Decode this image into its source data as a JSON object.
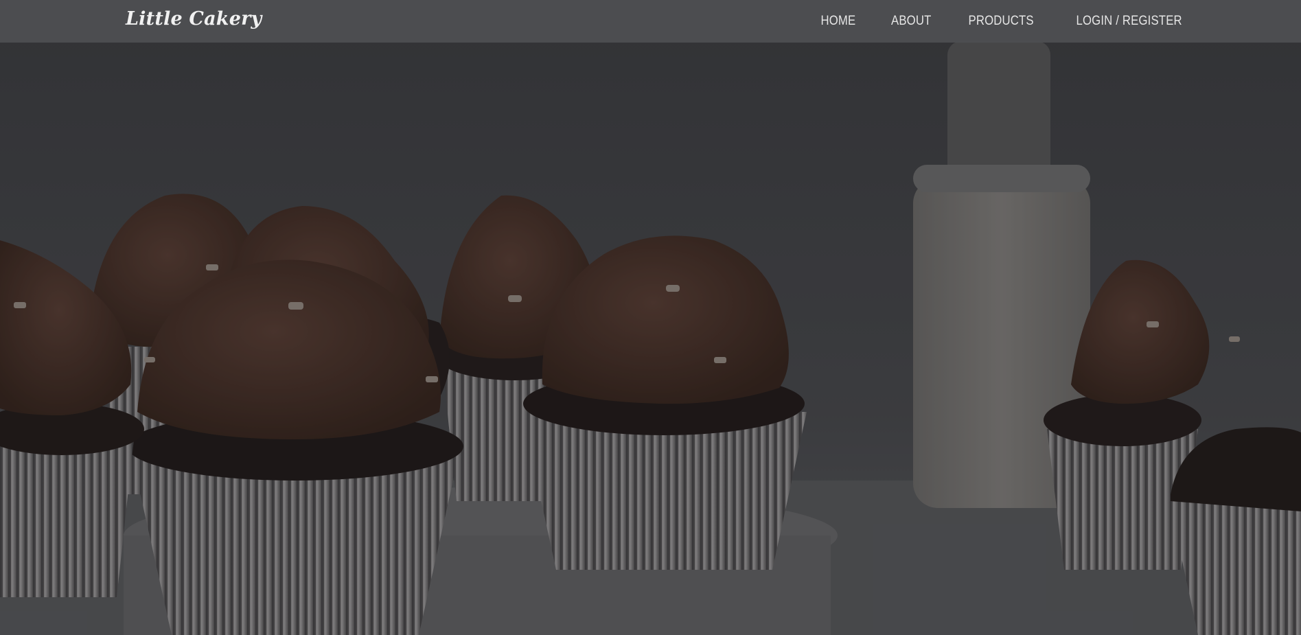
{
  "site": {
    "logo_text": "Little Cakery"
  },
  "nav": {
    "items": [
      {
        "label": "HOME"
      },
      {
        "label": "ABOUT"
      },
      {
        "label": "PRODUCTS"
      },
      {
        "label": "LOGIN / REGISTER"
      }
    ]
  },
  "hero": {
    "image_icon": "cupcakes-photo"
  },
  "colors": {
    "header_bg": "#4e4f52",
    "nav_text": "#e6e6e6",
    "logo_text": "#f1f1f1",
    "frosting": "#4a3128",
    "cake": "#231a18",
    "liner": "#9c9a9a",
    "background": "#3a3b3e"
  }
}
